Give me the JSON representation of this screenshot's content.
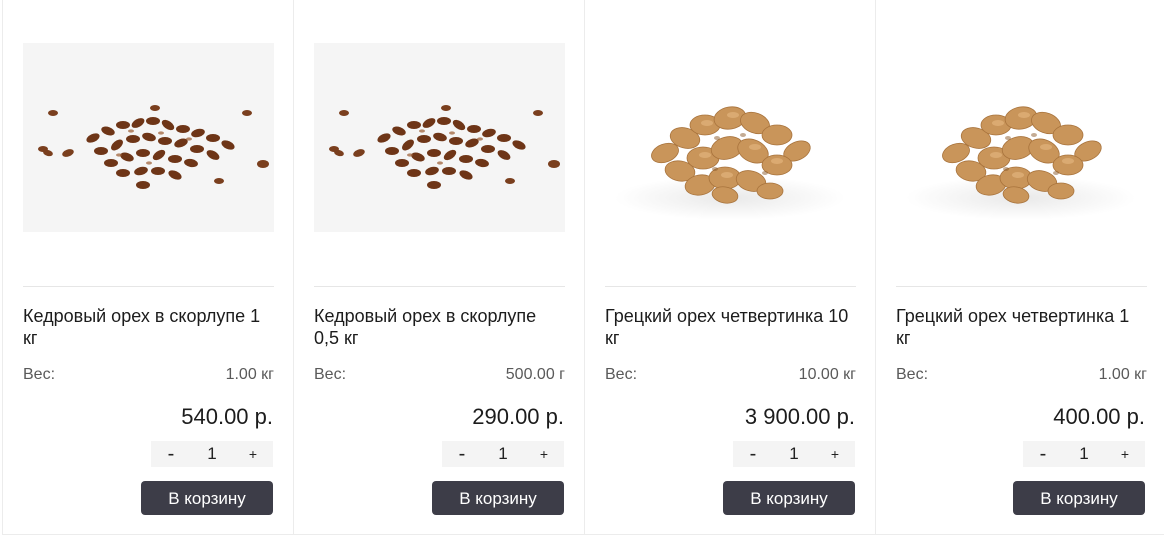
{
  "products": [
    {
      "image": "pine-nuts-photo",
      "title": "Кедровый орех в скорлупе 1 кг",
      "weight_label": "Вес:",
      "weight_value": "1.00 кг",
      "price": "540.00 р.",
      "qty_minus": "-",
      "qty_value": "1",
      "qty_plus": "+",
      "cart_label": "В корзину"
    },
    {
      "image": "pine-nuts-photo",
      "title": "Кедровый орех в скорлупе 0,5 кг",
      "weight_label": "Вес:",
      "weight_value": "500.00 г",
      "price": "290.00 р.",
      "qty_minus": "-",
      "qty_value": "1",
      "qty_plus": "+",
      "cart_label": "В корзину"
    },
    {
      "image": "walnut-quarters-photo",
      "title": "Грецкий орех четвертинка 10 кг",
      "weight_label": "Вес:",
      "weight_value": "10.00 кг",
      "price": "3 900.00 р.",
      "qty_minus": "-",
      "qty_value": "1",
      "qty_plus": "+",
      "cart_label": "В корзину"
    },
    {
      "image": "walnut-quarters-photo",
      "title": "Грецкий орех четвертинка 1 кг",
      "weight_label": "Вес:",
      "weight_value": "1.00 кг",
      "price": "400.00 р.",
      "qty_minus": "-",
      "qty_value": "1",
      "qty_plus": "+",
      "cart_label": "В корзину"
    }
  ],
  "colors": {
    "button_bg": "#3d3d48",
    "button_text": "#ffffff",
    "stepper_bg": "#f4f4f4",
    "pine_nut": "#7a3f1e",
    "walnut": "#c9955a"
  }
}
